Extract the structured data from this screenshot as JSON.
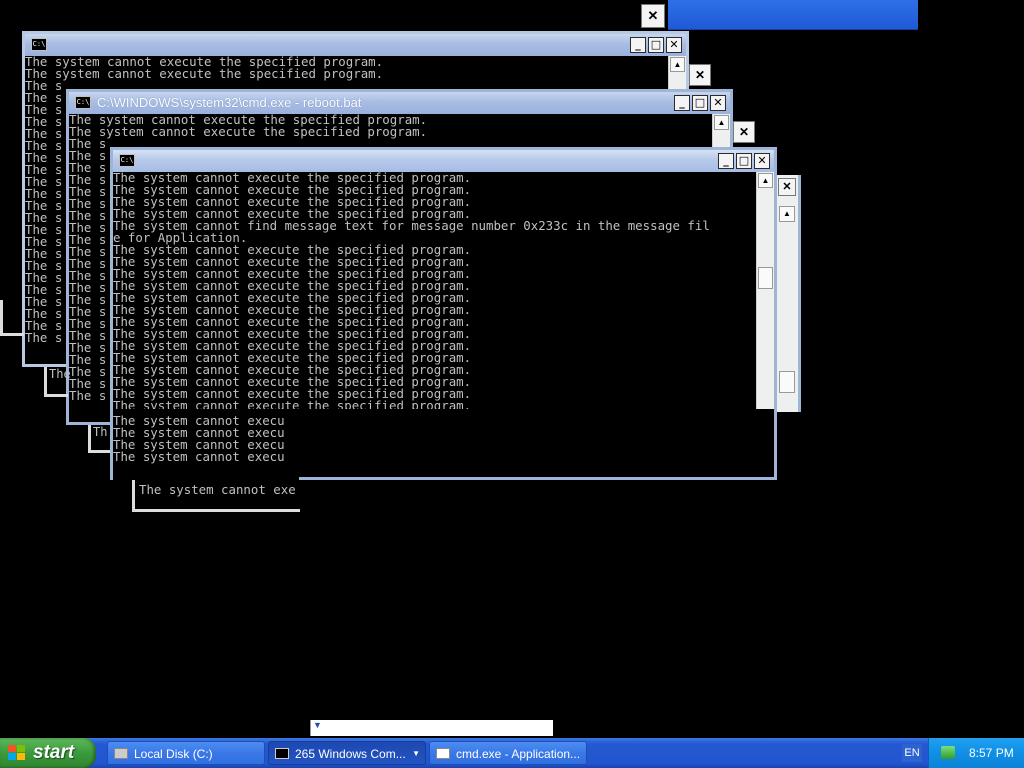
{
  "windows": [
    {
      "title": "",
      "lines": []
    },
    {
      "title": "",
      "lines": [
        "The system cannot execute the specified program.",
        "The system cannot execute the specified program.",
        "The s",
        "The s",
        "The s",
        "The s",
        "The s",
        "The s",
        "The s",
        "The s",
        "The s",
        "The s",
        "The s",
        "The s",
        "The s",
        "The s",
        "The s",
        "The s",
        "The s",
        "The s",
        "The s",
        "The s",
        "The s",
        "The s"
      ]
    },
    {
      "title": "C:\\WINDOWS\\system32\\cmd.exe - reboot.bat",
      "lines": [
        "The system cannot execute the specified program.",
        "The system cannot execute the specified program.",
        "The s",
        "The s",
        "The s",
        "The s",
        "The s",
        "The s",
        "The s",
        "The s",
        "The s",
        "The s",
        "The s",
        "The s",
        "The s",
        "The s",
        "The s",
        "The s",
        "The s",
        "The s",
        "The s",
        "The s",
        "The s",
        "The s"
      ]
    },
    {
      "title": "",
      "lines": [
        "The system cannot execute the specified program.",
        "The system cannot execute the specified program.",
        "The system cannot execute the specified program.",
        "The system cannot execute the specified program.",
        "The system cannot find message text for message number 0x233c in the message fil",
        "e for Application.",
        "The system cannot execute the specified program.",
        "The system cannot execute the specified program.",
        "The system cannot execute the specified program.",
        "The system cannot execute the specified program.",
        "The system cannot execute the specified program.",
        "The system cannot execute the specified program.",
        "The system cannot execute the specified program.",
        "The system cannot execute the specified program.",
        "The system cannot execute the specified program.",
        "The system cannot execute the specified program.",
        "The system cannot execute the specified program.",
        "The system cannot execute the specified program.",
        "The system cannot execute the specified program.",
        "The system cannot execute the specified program."
      ]
    }
  ],
  "fragments": {
    "lower_lines": [
      "The system cannot execu",
      "The system cannot execu",
      "The system cannot execu",
      "The system cannot execu"
    ],
    "ghost_text_1": "The system cannot exe",
    "ghost_text_2": "The",
    "ghost_text_3": "Th"
  },
  "buttons": {
    "minimize": "_",
    "maximize": "□",
    "close": "✕"
  },
  "taskbar": {
    "start_label": "start",
    "buttons": [
      {
        "label": "Local Disk (C:)",
        "icon": "drive-icon"
      },
      {
        "label": "265 Windows Com...",
        "icon": "cmd-icon"
      },
      {
        "label": "cmd.exe - Application...",
        "icon": "window-icon"
      }
    ],
    "language": "EN",
    "clock": "8:57 PM"
  },
  "colors": {
    "title_active": "#a6bce4",
    "taskbar": "#2459d2",
    "start": "#3b9a3b",
    "console_text": "#c0c0c0"
  }
}
